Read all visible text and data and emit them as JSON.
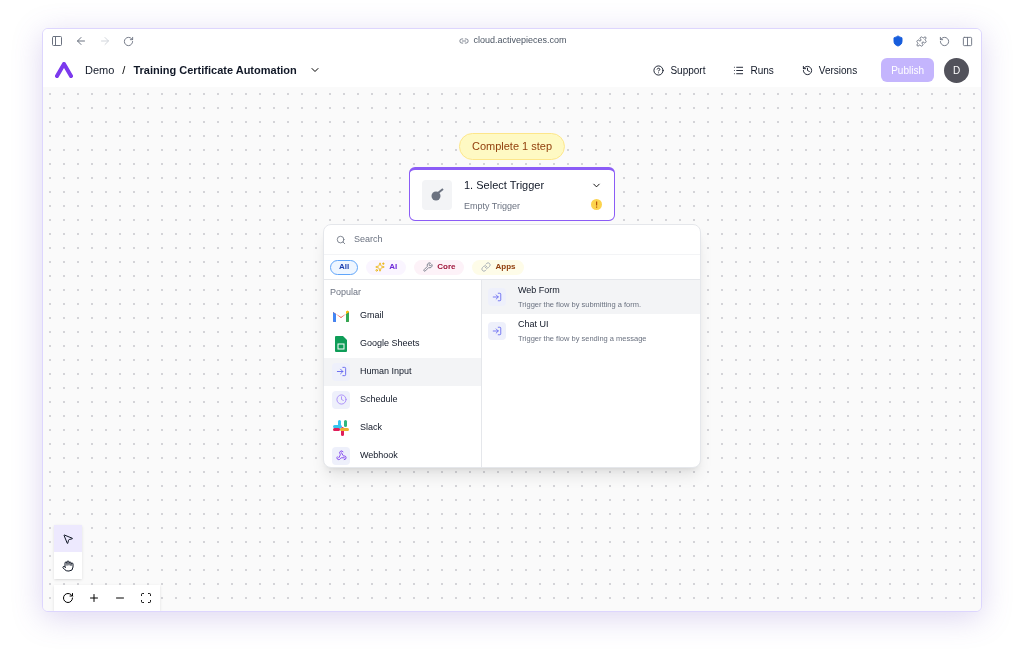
{
  "browser": {
    "url": "cloud.activepieces.com"
  },
  "header": {
    "project": "Demo",
    "separator": "/",
    "flow_name": "Training Certificate Automation",
    "actions": [
      "Support",
      "Runs",
      "Versions"
    ],
    "publish": {
      "label": "Publish",
      "disabled": true
    },
    "avatar": "D"
  },
  "canvas": {
    "banner": "Complete 1 step",
    "step": {
      "title": "1. Select Trigger",
      "subtitle": "Empty Trigger",
      "warning": true
    },
    "picker": {
      "search": {
        "placeholder": "Search"
      },
      "filters": [
        {
          "label": "All",
          "selected": true
        },
        {
          "label": "AI",
          "selected": false
        },
        {
          "label": "Core",
          "selected": false
        },
        {
          "label": "Apps",
          "selected": false
        }
      ],
      "section": "Popular",
      "pieces": [
        {
          "name": "Gmail",
          "selected": false
        },
        {
          "name": "Google Sheets",
          "selected": false
        },
        {
          "name": "Human Input",
          "selected": true
        },
        {
          "name": "Schedule",
          "selected": false
        },
        {
          "name": "Slack",
          "selected": false
        },
        {
          "name": "Webhook",
          "selected": false
        }
      ],
      "triggers": [
        {
          "name": "Web Form",
          "description": "Trigger the flow by submitting a form.",
          "selected": true
        },
        {
          "name": "Chat UI",
          "description": "Trigger the flow by sending a message",
          "selected": false
        }
      ]
    },
    "tools": [
      {
        "selected": true
      },
      {
        "selected": false
      }
    ]
  }
}
